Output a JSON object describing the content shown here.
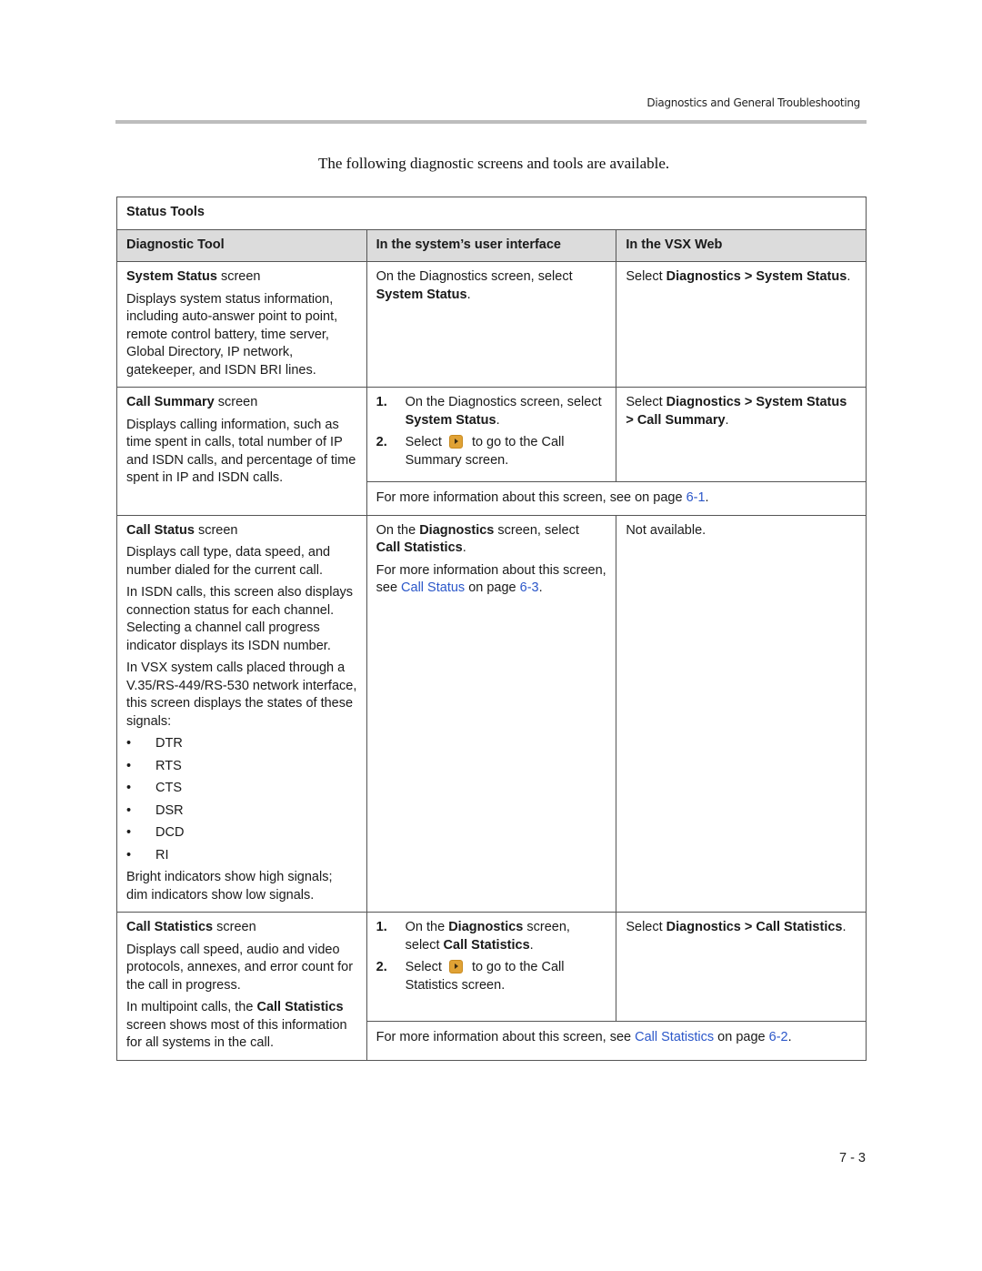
{
  "running_head": "Diagnostics and General Troubleshooting",
  "intro": "The following diagnostic screens and tools are available.",
  "table": {
    "title": "Status Tools",
    "headers": [
      "Diagnostic Tool",
      "In the system’s user interface",
      "In the VSX Web"
    ],
    "rows": [
      {
        "tool_name": "System Status",
        "tool_suffix": " screen",
        "desc": [
          "Displays system status information, including auto-answer point to point, remote control battery, time server, Global Directory, IP network, gatekeeper, and ISDN BRI lines."
        ],
        "ui": {
          "pre": "On the Diagnostics screen, select ",
          "bold": "System Status",
          "post": "."
        },
        "web": {
          "pre": "Select ",
          "bold": "Diagnostics > System Status",
          "post": "."
        }
      },
      {
        "tool_name": "Call Summary",
        "tool_suffix": " screen",
        "desc": [
          "Displays calling information, such as time spent in calls, total number of IP and ISDN calls, and percentage of time spent in IP and ISDN calls."
        ],
        "ui_steps": [
          {
            "num": "1.",
            "pre": "On the Diagnostics screen, select ",
            "bold": "System Status",
            "post": "."
          },
          {
            "num": "2.",
            "pre": "Select",
            "icon": "forward-arrow-icon",
            "post": "to go to the Call Summary screen."
          }
        ],
        "web": {
          "pre": "Select ",
          "bold": "Diagnostics > System Status > Call Summary",
          "post": "."
        },
        "more": {
          "pre": "For more information about this screen, see on page ",
          "link": "6-1",
          "post": "."
        }
      },
      {
        "tool_name": "Call Status",
        "tool_suffix": " screen",
        "desc": [
          "Displays call type, data speed, and number dialed for the current call.",
          "In ISDN calls, this screen also displays connection status for each channel. Selecting a channel call progress indicator displays its ISDN number.",
          "In VSX system calls placed through a V.35/RS-449/RS-530 network interface, this screen displays the states of these signals:"
        ],
        "signals": [
          "DTR",
          "RTS",
          "CTS",
          "DSR",
          "DCD",
          "RI"
        ],
        "desc_after": "Bright indicators show high signals; dim indicators show low signals.",
        "ui": {
          "pre": "On the ",
          "bold1": "Diagnostics",
          "mid": " screen, select ",
          "bold": "Call Statistics",
          "post": "."
        },
        "ui_more": {
          "pre": "For more information about this screen, see ",
          "link": "Call Status",
          "mid": " on page ",
          "link2": "6-3",
          "post": "."
        },
        "web_text": "Not available."
      },
      {
        "tool_name": "Call Statistics",
        "tool_suffix": " screen",
        "desc": [
          "Displays call speed, audio and video protocols, annexes, and error count for the call in progress."
        ],
        "desc2": {
          "pre": "In multipoint calls, the ",
          "bold": "Call Statistics",
          "post": " screen shows most of this information for all systems in the call."
        },
        "ui_steps": [
          {
            "num": "1.",
            "pre": "On the ",
            "bold1": "Diagnostics",
            "mid": " screen, select ",
            "bold": "Call Statistics",
            "post": "."
          },
          {
            "num": "2.",
            "pre": "Select",
            "icon": "forward-arrow-icon",
            "post": "to go to the Call Statistics screen."
          }
        ],
        "web": {
          "pre": "Select ",
          "bold": "Diagnostics > Call Statistics",
          "post": "."
        },
        "more": {
          "pre": "For more information about this screen, see ",
          "link": "Call Statistics",
          "mid": " on page ",
          "link2": "6-2",
          "post": "."
        }
      }
    ]
  },
  "page_number": "7 - 3",
  "colors": {
    "link": "#2b57c9",
    "header_bg": "#dcdcdc",
    "rule": "#bdbdbd",
    "icon": "#e0a235"
  }
}
